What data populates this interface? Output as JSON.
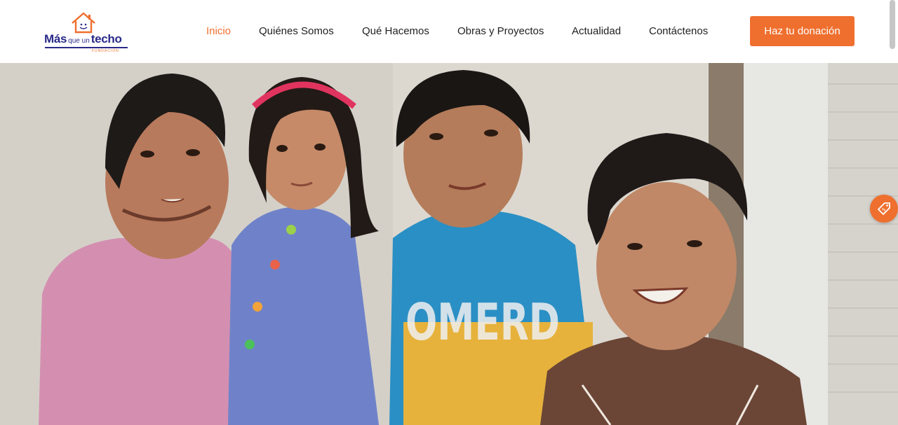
{
  "logo": {
    "word_mas": "Más",
    "word_que_un": "que un",
    "word_techo": "techo",
    "word_fundacion": "FUNDACIÓN"
  },
  "nav": {
    "items": [
      {
        "label": "Inicio",
        "active": true
      },
      {
        "label": "Quiénes Somos",
        "active": false
      },
      {
        "label": "Qué Hacemos",
        "active": false
      },
      {
        "label": "Obras y Proyectos",
        "active": false
      },
      {
        "label": "Actualidad",
        "active": false
      },
      {
        "label": "Contáctenos",
        "active": false
      }
    ]
  },
  "cta": {
    "donate_label": "Haz tu donación"
  },
  "hero": {
    "image_icon": "family-photo"
  },
  "floating": {
    "icon": "donation-tag-icon"
  },
  "colors": {
    "accent": "#ef6f2e",
    "brand_blue": "#2a2a8a",
    "nav_text": "#1f1f1f"
  }
}
